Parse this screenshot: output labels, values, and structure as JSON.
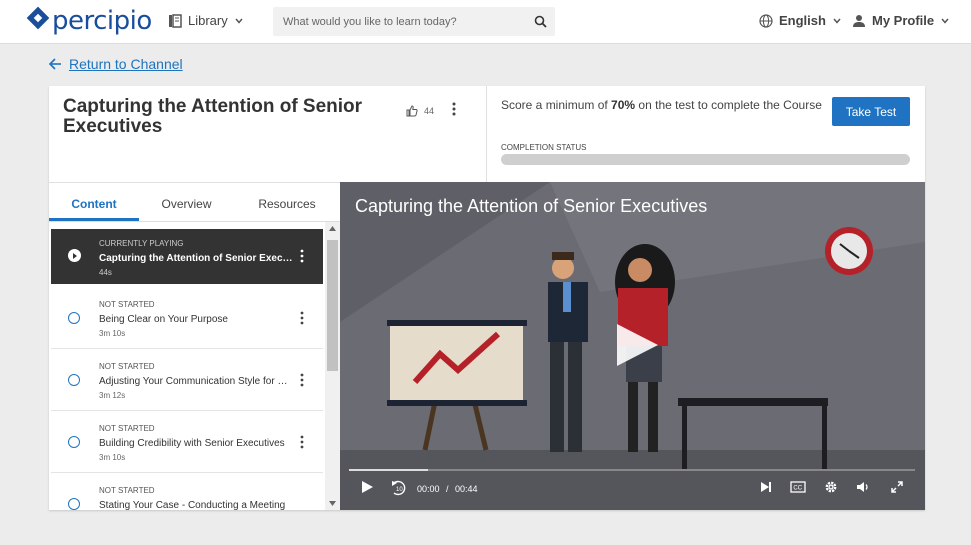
{
  "header": {
    "logo_text": "percipio",
    "library_label": "Library",
    "search_placeholder": "What would you like to learn today?",
    "language_label": "English",
    "profile_label": "My Profile"
  },
  "nav": {
    "return_label": "Return to Channel"
  },
  "course": {
    "title": "Capturing the Attention of Senior Executives",
    "likes": "44",
    "score_prefix": "Score a minimum of",
    "score_value": "70%",
    "score_suffix": "on the test to complete the Course",
    "take_test_label": "Take Test",
    "completion_label": "COMPLETION STATUS",
    "completion_fraction": 0
  },
  "tabs": [
    {
      "label": "Content",
      "active": true
    },
    {
      "label": "Overview",
      "active": false
    },
    {
      "label": "Resources",
      "active": false
    }
  ],
  "items": [
    {
      "status": "CURRENTLY PLAYING",
      "name": "Capturing the Attention of Senior Executives",
      "duration": "44s",
      "current": true
    },
    {
      "status": "NOT STARTED",
      "name": "Being Clear on Your Purpose",
      "duration": "3m 10s",
      "current": false
    },
    {
      "status": "NOT STARTED",
      "name": "Adjusting Your Communication Style for Senior Executives",
      "duration": "3m 12s",
      "current": false
    },
    {
      "status": "NOT STARTED",
      "name": "Building Credibility with Senior Executives",
      "duration": "3m 10s",
      "current": false
    },
    {
      "status": "NOT STARTED",
      "name": "Stating Your Case - Conducting a Meeting",
      "duration": "",
      "current": false
    }
  ],
  "video": {
    "title": "Capturing the Attention of Senior Executives",
    "current_time": "00:00",
    "separator": "/",
    "total_time": "00:44",
    "progress_fraction": 0.14,
    "cc_label": "CC",
    "skip_label": "10"
  },
  "colors": {
    "brand": "#1a4e9c",
    "accent": "#1f73c2",
    "video_bg": "#6b6b73",
    "current_item_bg": "#333333"
  }
}
